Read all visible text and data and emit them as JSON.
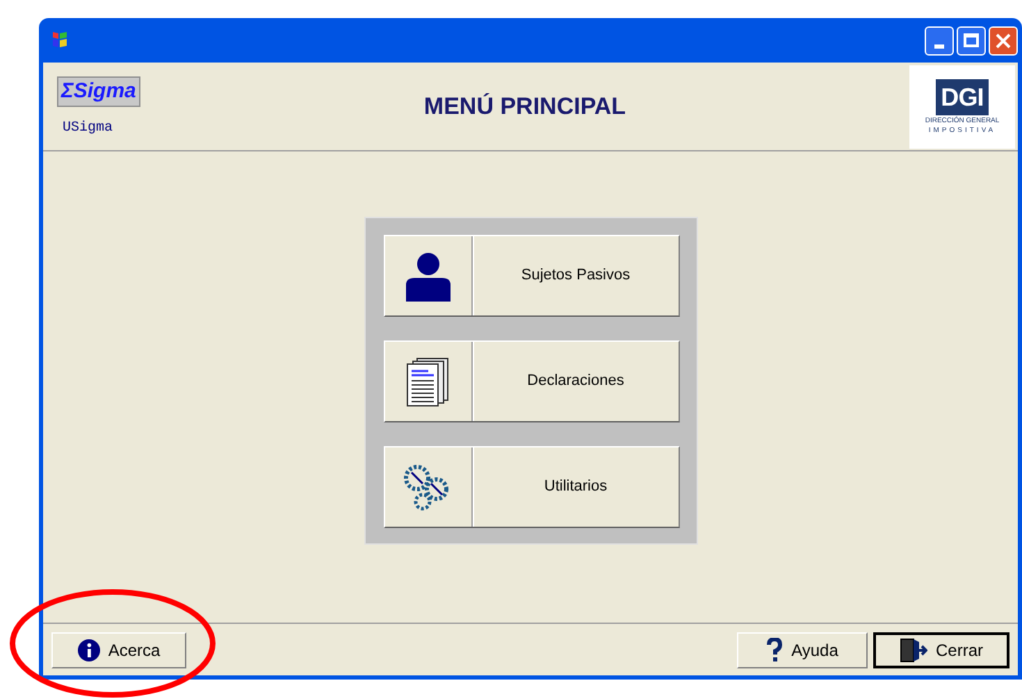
{
  "header": {
    "app_logo": "ΣSigma",
    "user": "USigma",
    "title": "MENÚ PRINCIPAL",
    "agency_logo": {
      "mark": "DGI",
      "line_1": "DIRECCIÓN GENERAL",
      "line_2": "IMPOSITIVA"
    }
  },
  "menu": [
    {
      "kind": "person",
      "label": "Sujetos Pasivos"
    },
    {
      "kind": "documents",
      "label": "Declaraciones"
    },
    {
      "kind": "gears",
      "label": "Utilitarios"
    }
  ],
  "footer_left": [
    {
      "kind": "info",
      "label": "Acerca",
      "default": false
    }
  ],
  "footer_right": [
    {
      "kind": "help",
      "label": "Ayuda",
      "default": false
    },
    {
      "kind": "exit",
      "label": "Cerrar",
      "default": true
    }
  ],
  "annotation": {
    "kind": "ellipse",
    "color": "#ff0000"
  }
}
